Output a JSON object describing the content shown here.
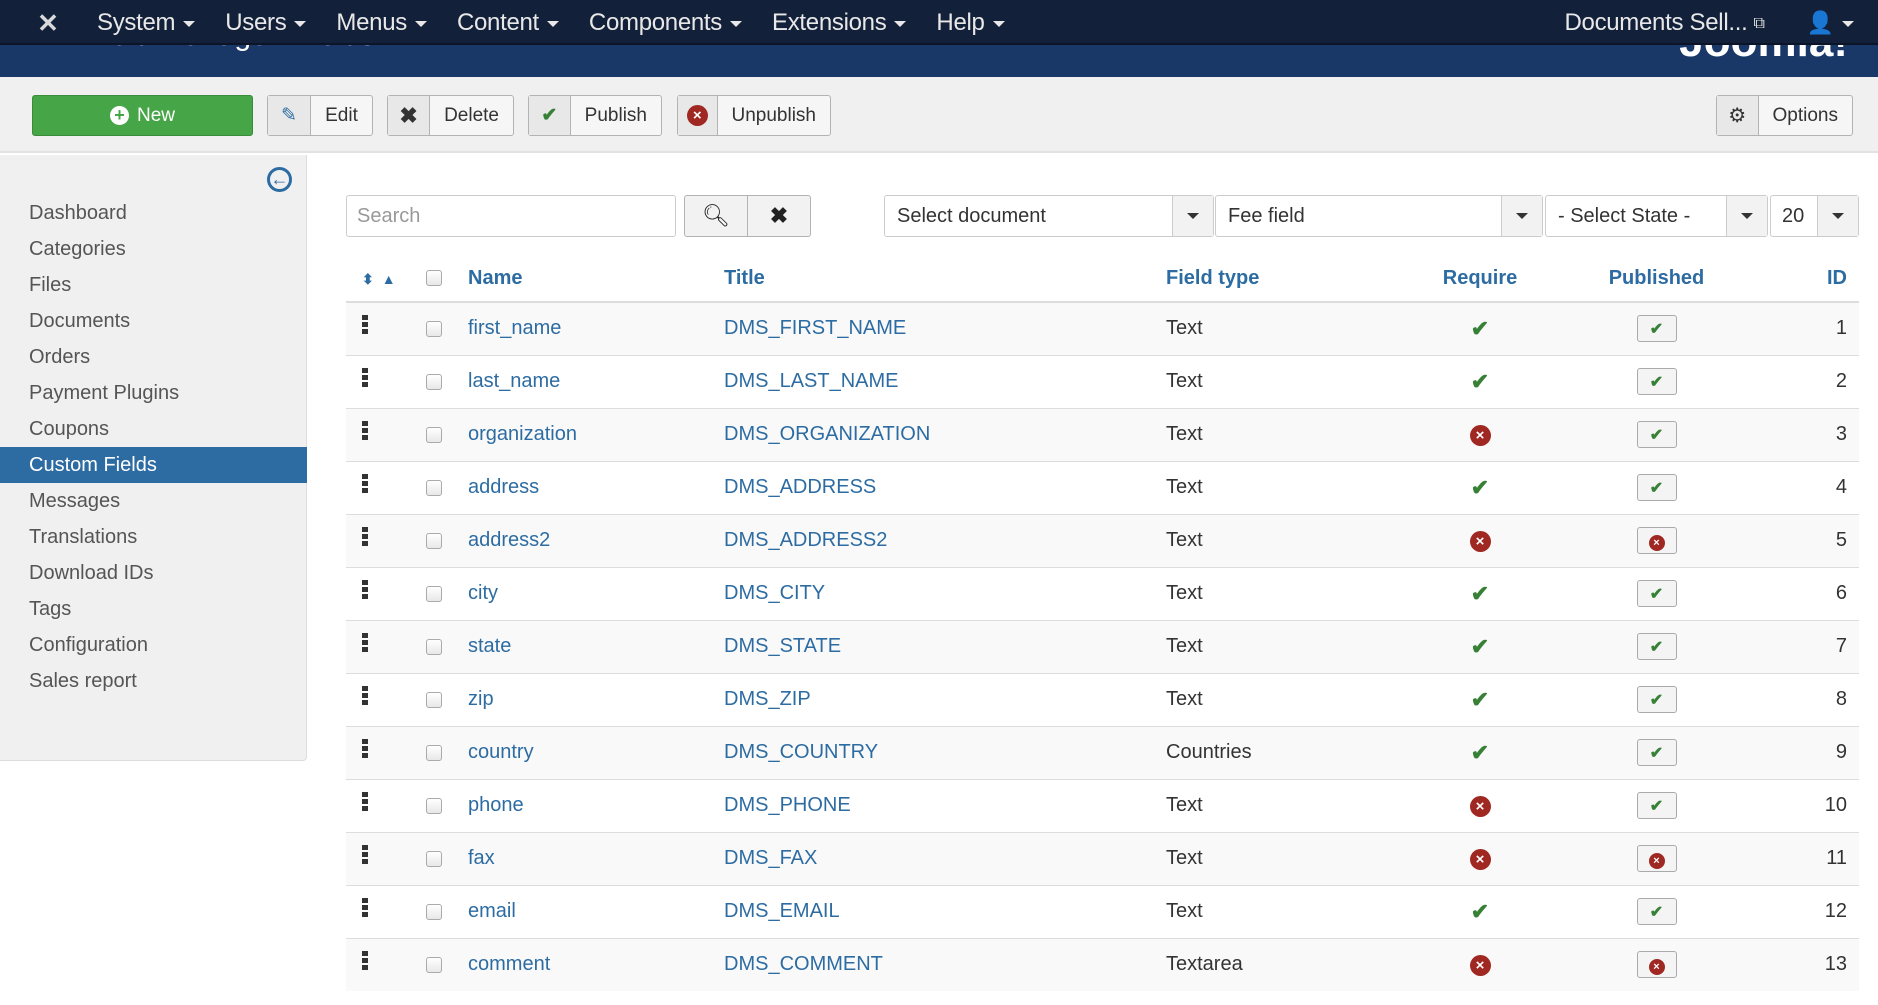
{
  "navbar": {
    "menu": [
      {
        "label": "System"
      },
      {
        "label": "Users"
      },
      {
        "label": "Menus"
      },
      {
        "label": "Content"
      },
      {
        "label": "Components"
      },
      {
        "label": "Extensions"
      },
      {
        "label": "Help"
      }
    ],
    "site_label": "Documents Sell..."
  },
  "header": {
    "title": "Field Manager: Fields",
    "logo_text": "Joomla!"
  },
  "toolbar": {
    "new_label": "New",
    "edit_label": "Edit",
    "delete_label": "Delete",
    "publish_label": "Publish",
    "unpublish_label": "Unpublish",
    "options_label": "Options"
  },
  "sidebar": {
    "items": [
      {
        "label": "Dashboard",
        "active": false
      },
      {
        "label": "Categories",
        "active": false
      },
      {
        "label": "Files",
        "active": false
      },
      {
        "label": "Documents",
        "active": false
      },
      {
        "label": "Orders",
        "active": false
      },
      {
        "label": "Payment Plugins",
        "active": false
      },
      {
        "label": "Coupons",
        "active": false
      },
      {
        "label": "Custom Fields",
        "active": true
      },
      {
        "label": "Messages",
        "active": false
      },
      {
        "label": "Translations",
        "active": false
      },
      {
        "label": "Download IDs",
        "active": false
      },
      {
        "label": "Tags",
        "active": false
      },
      {
        "label": "Configuration",
        "active": false
      },
      {
        "label": "Sales report",
        "active": false
      }
    ]
  },
  "filters": {
    "search_placeholder": "Search",
    "search_value": "",
    "document_select": "Select document",
    "fee_select": "Fee field",
    "state_select": "- Select State -",
    "limit_select": "20"
  },
  "table": {
    "headers": {
      "name": "Name",
      "title": "Title",
      "field_type": "Field type",
      "require": "Require",
      "published": "Published",
      "id": "ID"
    },
    "rows": [
      {
        "name": "first_name",
        "title": "DMS_FIRST_NAME",
        "type": "Text",
        "require": true,
        "published": true,
        "id": "1"
      },
      {
        "name": "last_name",
        "title": "DMS_LAST_NAME",
        "type": "Text",
        "require": true,
        "published": true,
        "id": "2"
      },
      {
        "name": "organization",
        "title": "DMS_ORGANIZATION",
        "type": "Text",
        "require": false,
        "published": true,
        "id": "3"
      },
      {
        "name": "address",
        "title": "DMS_ADDRESS",
        "type": "Text",
        "require": true,
        "published": true,
        "id": "4"
      },
      {
        "name": "address2",
        "title": "DMS_ADDRESS2",
        "type": "Text",
        "require": false,
        "published": false,
        "id": "5"
      },
      {
        "name": "city",
        "title": "DMS_CITY",
        "type": "Text",
        "require": true,
        "published": true,
        "id": "6"
      },
      {
        "name": "state",
        "title": "DMS_STATE",
        "type": "Text",
        "require": true,
        "published": true,
        "id": "7"
      },
      {
        "name": "zip",
        "title": "DMS_ZIP",
        "type": "Text",
        "require": true,
        "published": true,
        "id": "8"
      },
      {
        "name": "country",
        "title": "DMS_COUNTRY",
        "type": "Countries",
        "require": true,
        "published": true,
        "id": "9"
      },
      {
        "name": "phone",
        "title": "DMS_PHONE",
        "type": "Text",
        "require": false,
        "published": true,
        "id": "10"
      },
      {
        "name": "fax",
        "title": "DMS_FAX",
        "type": "Text",
        "require": false,
        "published": false,
        "id": "11"
      },
      {
        "name": "email",
        "title": "DMS_EMAIL",
        "type": "Text",
        "require": true,
        "published": true,
        "id": "12"
      },
      {
        "name": "comment",
        "title": "DMS_COMMENT",
        "type": "Textarea",
        "require": false,
        "published": false,
        "id": "13"
      }
    ]
  },
  "colors": {
    "navbar_bg": "#132039",
    "header_bg": "#1a3867",
    "accent_blue": "#2d6ca2",
    "new_button": "#46a546",
    "check_green": "#378137",
    "error_red": "#a02822"
  }
}
